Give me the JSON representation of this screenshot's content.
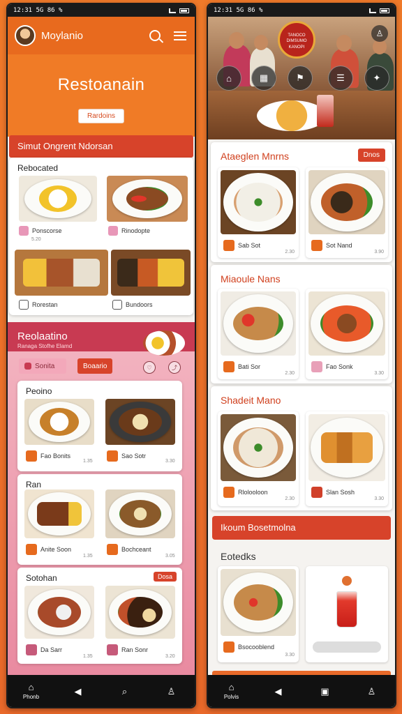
{
  "left": {
    "status_time": "12:31 5G 86 %",
    "app_name": "Moylanio",
    "hero_title": "Restoanain",
    "hero_button": "Rardoins",
    "section1_title": "Simut Ongrent Ndorsan",
    "card1": {
      "title": "Rebocated",
      "items": [
        {
          "name": "Ponscorse",
          "price": "5.20"
        },
        {
          "name": "Rinodopte",
          "price": ""
        },
        {
          "name": "Rorestan",
          "price": ""
        },
        {
          "name": "Bundoors",
          "price": ""
        }
      ]
    },
    "pink": {
      "title": "Reolaatino",
      "subtitle": "Ranaga Stofhe Elamd",
      "chip1": "Sonita",
      "chip2": "Boaario",
      "blocks": [
        {
          "title": "Peoino",
          "items": [
            {
              "name": "Fao Bonits",
              "price": "1.35"
            },
            {
              "name": "Sao Sotr",
              "price": "3.30"
            }
          ]
        },
        {
          "title": "Ran",
          "items": [
            {
              "name": "Anite Soon",
              "price": "1.35"
            },
            {
              "name": "Bochceant",
              "price": "3.05"
            }
          ]
        },
        {
          "title": "Sotohan",
          "badge": "Dosa",
          "items": [
            {
              "name": "Da Sarr",
              "price": "1.35"
            },
            {
              "name": "Ran Sonr",
              "price": "3.20"
            }
          ]
        }
      ]
    },
    "nav": {
      "home": "Phonb"
    }
  },
  "right": {
    "status_time": "12:31 5G 86 %",
    "logo_text": "TANOCO DIMSUMO KANOPI",
    "categories": [
      "⌂",
      "▦",
      "⚑",
      "☰",
      "✦"
    ],
    "sections": [
      {
        "title": "Ataeglen Mnrns",
        "button": "Dnos",
        "items": [
          {
            "name": "Sab Sot",
            "price": "2.30"
          },
          {
            "name": "Sot Nand",
            "price": "3.90"
          }
        ]
      },
      {
        "title": "Miaoule Nans",
        "items": [
          {
            "name": "Bati Sor",
            "price": "2.30"
          },
          {
            "name": "Fao Sonk",
            "price": "3.30"
          }
        ]
      },
      {
        "title": "Shadeit Mano",
        "items": [
          {
            "name": "Rlolooloon",
            "price": "2.30"
          },
          {
            "name": "Slan Sosh",
            "price": "3.30"
          }
        ]
      }
    ],
    "banner": "Ikoum Bosetmolna",
    "last_title": "Eotedks",
    "last_items": [
      {
        "name": "Bsocooblend",
        "price": "3.30"
      }
    ],
    "nav": {
      "home": "Polvis"
    }
  }
}
